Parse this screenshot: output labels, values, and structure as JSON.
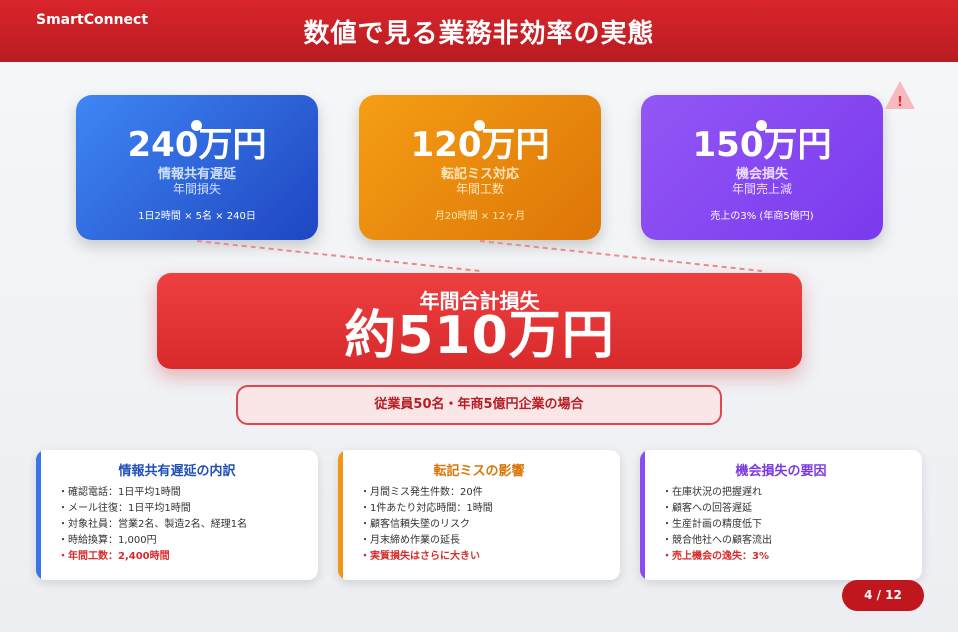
{
  "header": {
    "brand": "SmartConnect",
    "title": "数値で見る業務非効率の実態"
  },
  "cards": [
    {
      "value": "240万円",
      "label": "情報共有遅延",
      "sub": "年間損失",
      "formula": "1日2時間 × 5名 × 240日"
    },
    {
      "value": "120万円",
      "label": "転記ミス対応",
      "sub": "年間工数",
      "formula": "月20時間 × 12ヶ月"
    },
    {
      "value": "150万円",
      "label": "機会損失",
      "sub": "年間売上減",
      "formula": "売上の3% (年商5億円)"
    }
  ],
  "warning": {
    "icon": "warning-triangle-icon",
    "symbol": "!"
  },
  "total": {
    "label": "年間合計損失",
    "value": "約510万円"
  },
  "condition": "従業員50名・年商5億円企業の場合",
  "details": [
    {
      "title": "情報共有遅延の内訳",
      "items": [
        "確認電話：1日平均1時間",
        "メール往復：1日平均1時間",
        "対象社員：営業2名、製造2名、経理1名",
        "時給換算：1,000円"
      ],
      "highlight": "年間工数：2,400時間"
    },
    {
      "title": "転記ミスの影響",
      "items": [
        "月間ミス発生件数：20件",
        "1件あたり対応時間：1時間",
        "顧客信頼失墜のリスク",
        "月末締め作業の延長"
      ],
      "highlight": "実質損失はさらに大きい"
    },
    {
      "title": "機会損失の要因",
      "items": [
        "在庫状況の把握遅れ",
        "顧客への回答遅延",
        "生産計画の精度低下",
        "競合他社への顧客流出"
      ],
      "highlight": "売上機会の逸失：3%"
    }
  ],
  "pager": "4 / 12",
  "colors": {
    "header": "#c81f25",
    "blue": "#2f63dc",
    "orange": "#ec8a0e",
    "purple": "#853fee",
    "total": "#e33535"
  }
}
